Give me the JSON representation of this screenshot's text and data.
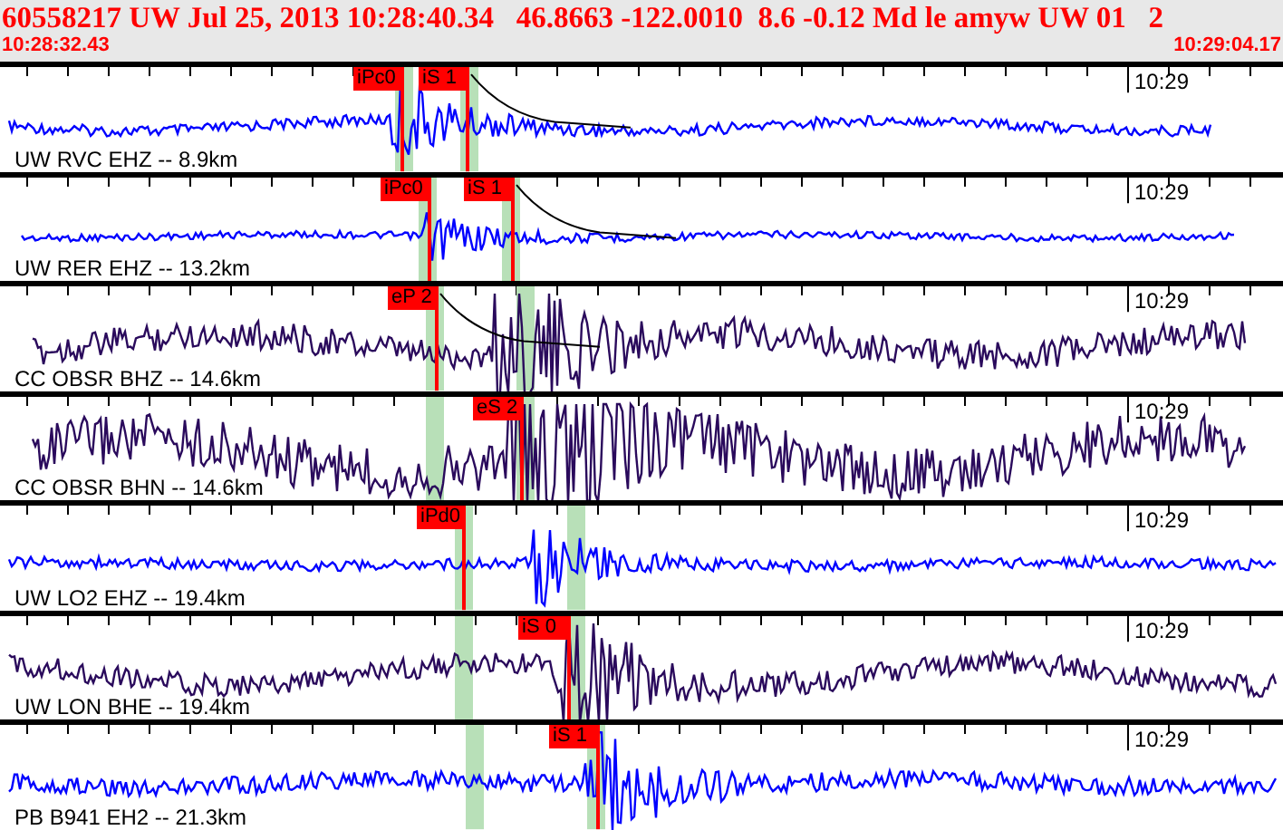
{
  "header": {
    "title": "60558217 UW Jul 25, 2013 10:28:40.34   46.8663 -122.0010  8.6 -0.12 Md le amyw UW 01   2",
    "start_time": "10:28:32.43",
    "end_time": "10:29:04.17"
  },
  "channels": [
    {
      "label": "UW RVC EHZ -- 8.9km",
      "time_label": "10:29",
      "color": "#0000ff",
      "picks": [
        {
          "label": "iPc0"
        },
        {
          "label": "iS 1"
        }
      ]
    },
    {
      "label": "UW RER EHZ -- 13.2km",
      "time_label": "10:29",
      "color": "#0000ff",
      "picks": [
        {
          "label": "iPc0"
        },
        {
          "label": "iS 1"
        }
      ]
    },
    {
      "label": "CC OBSR BHZ -- 14.6km",
      "time_label": "10:29",
      "color": "#2a0a5c",
      "picks": [
        {
          "label": "eP 2"
        }
      ]
    },
    {
      "label": "CC OBSR BHN -- 14.6km",
      "time_label": "10:29",
      "color": "#2a0a5c",
      "picks": [
        {
          "label": "eS 2"
        }
      ]
    },
    {
      "label": "UW LO2 EHZ -- 19.4km",
      "time_label": "10:29",
      "color": "#0000ff",
      "picks": [
        {
          "label": "iPd0"
        }
      ]
    },
    {
      "label": "UW LON BHE -- 19.4km",
      "time_label": "10:29",
      "color": "#2a0a5c",
      "picks": [
        {
          "label": "iS 0"
        }
      ]
    },
    {
      "label": "PB B941 EH2 -- 21.3km",
      "time_label": "10:29",
      "color": "#0000ff",
      "picks": [
        {
          "label": "iS 1"
        }
      ]
    }
  ]
}
